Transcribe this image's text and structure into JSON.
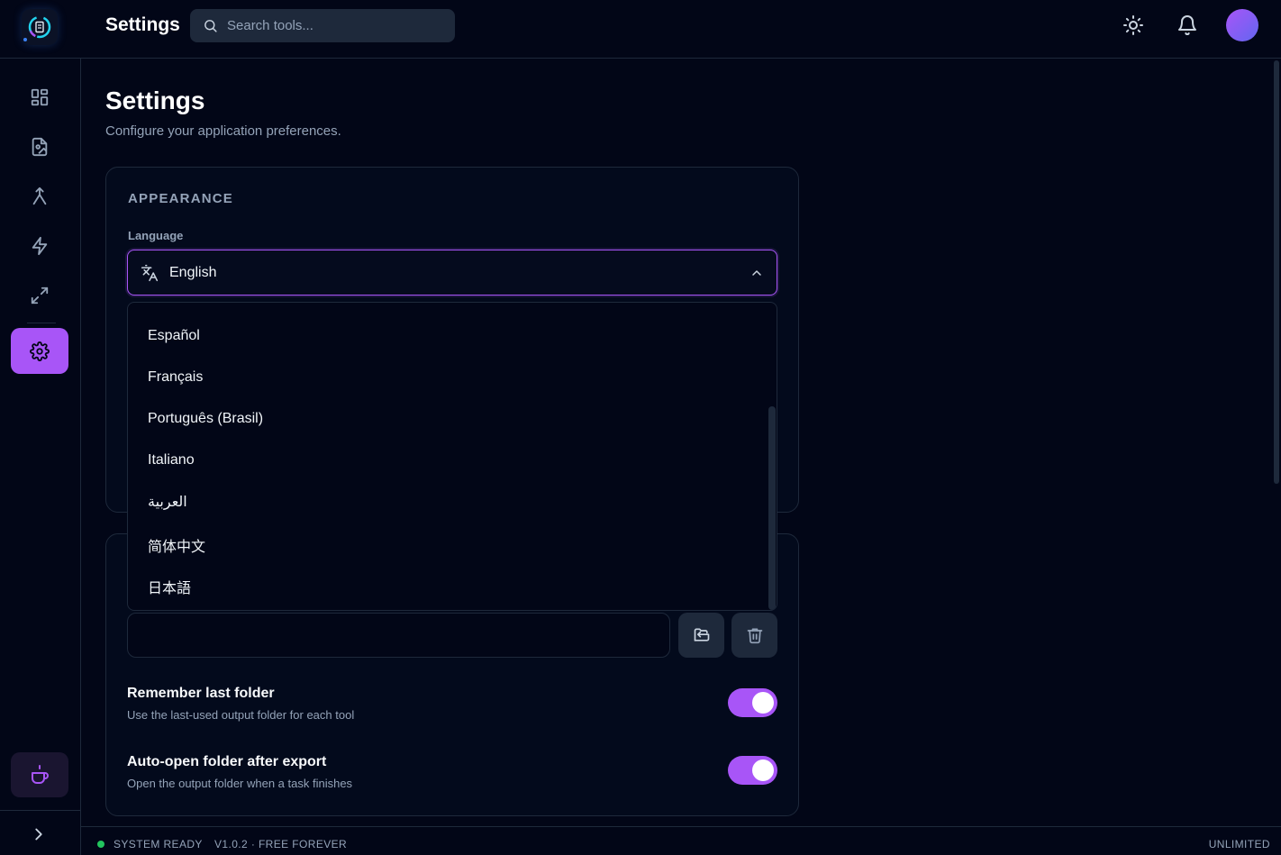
{
  "header": {
    "title": "Settings",
    "search_placeholder": "Search tools...",
    "icons": [
      "sun-icon",
      "bell-icon",
      "avatar"
    ]
  },
  "sidebar": {
    "items": [
      {
        "icon": "grid-icon",
        "active": false
      },
      {
        "icon": "file-image-icon",
        "active": false
      },
      {
        "icon": "merge-icon",
        "active": false
      },
      {
        "icon": "lightning-icon",
        "active": false
      },
      {
        "icon": "expand-arrows-icon",
        "active": false
      },
      {
        "icon": "gear-icon",
        "active": true
      }
    ],
    "bottom": [
      "coffee-icon",
      "chevron-right-icon"
    ]
  },
  "page": {
    "title": "Settings",
    "subtitle": "Configure your application preferences."
  },
  "appearance": {
    "section_title": "APPEARANCE",
    "language_label": "Language",
    "language_value": "English",
    "language_options": [
      "Español",
      "Français",
      "Português (Brasil)",
      "Italiano",
      "العربية",
      "简体中文",
      "日本語"
    ]
  },
  "output": {
    "remember_title": "Remember last folder",
    "remember_desc": "Use the last-used output folder for each tool",
    "remember_on": true,
    "autoopen_title": "Auto-open folder after export",
    "autoopen_desc": "Open the output folder when a task finishes",
    "autoopen_on": true
  },
  "footer": {
    "status": "SYSTEM READY",
    "version": "V1.0.2 · FREE FOREVER",
    "plan": "UNLIMITED"
  },
  "colors": {
    "background": "#020617",
    "accent": "#a855f7",
    "border": "#1e293b",
    "muted_text": "#94a3b8",
    "status_green": "#22c55e"
  }
}
